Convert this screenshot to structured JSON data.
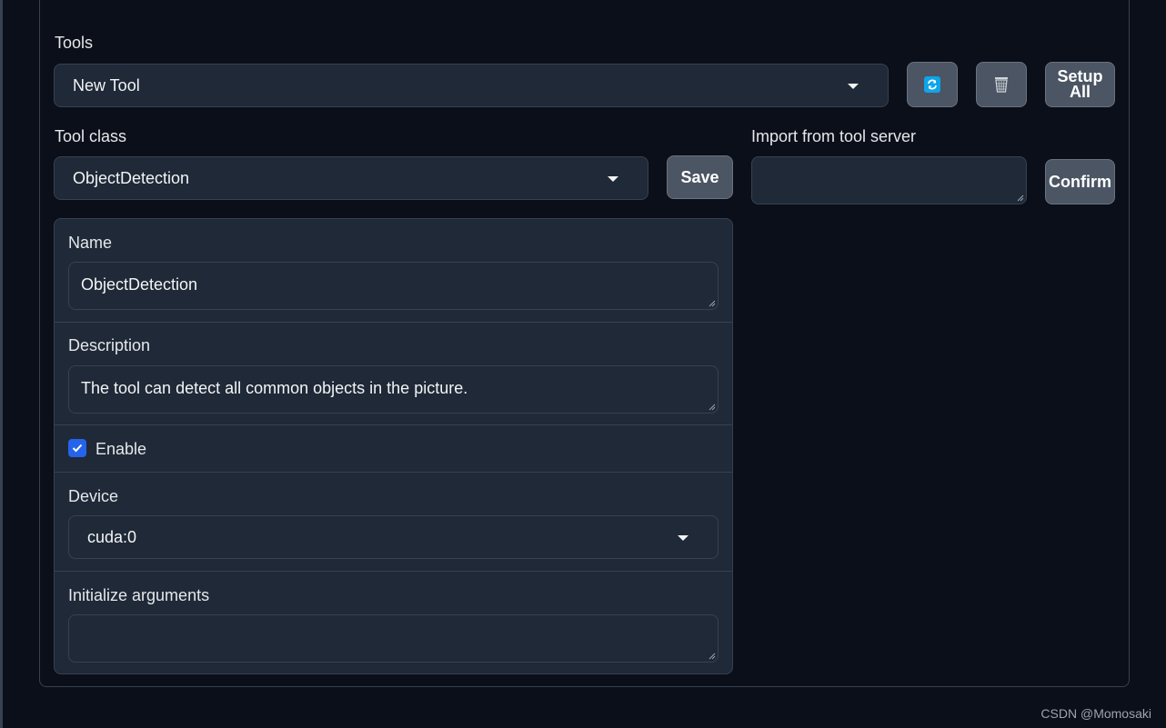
{
  "tools": {
    "label": "Tools",
    "selected": "New Tool",
    "refresh_icon": "refresh-icon",
    "delete_icon": "trash-icon",
    "setup_all_line1": "Setup",
    "setup_all_line2": "All"
  },
  "tool_class": {
    "label": "Tool class",
    "selected": "ObjectDetection",
    "save_label": "Save"
  },
  "import": {
    "label": "Import from tool server",
    "value": "",
    "confirm_label": "Confirm"
  },
  "form": {
    "name_label": "Name",
    "name_value": "ObjectDetection",
    "description_label": "Description",
    "description_value": "The tool can detect all common objects in the picture.",
    "enable_label": "Enable",
    "enable_checked": true,
    "device_label": "Device",
    "device_value": "cuda:0",
    "init_args_label": "Initialize arguments",
    "init_args_value": ""
  },
  "watermark": "CSDN @Momosaki",
  "colors": {
    "background": "#0b0f19",
    "panel": "#1f2937",
    "border": "#374151",
    "button": "#4b5563",
    "accent": "#2563eb",
    "refresh_icon": "#0ea5e9"
  }
}
